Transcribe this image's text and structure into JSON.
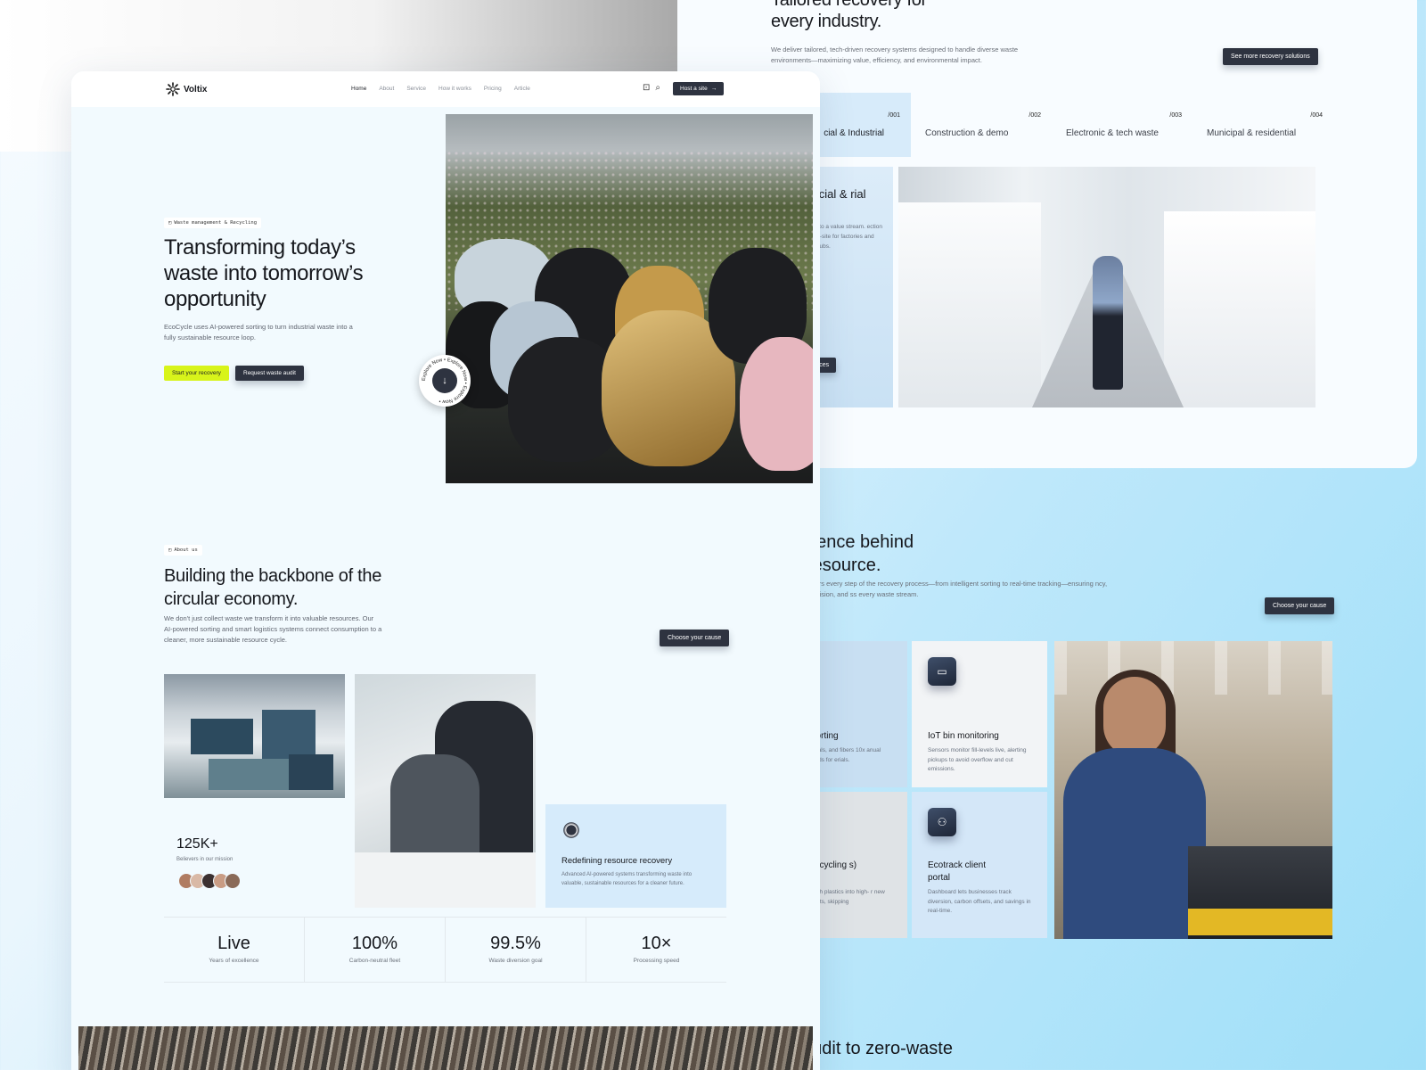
{
  "front": {
    "brand": "Voltix",
    "nav": {
      "links": [
        "Home",
        "About",
        "Service",
        "How it works",
        "Pricing",
        "Article"
      ],
      "host_button": "Host a site"
    },
    "hero": {
      "tag": "Waste management & Recycling",
      "title": "Transforming today’s waste into tomorrow’s opportunity",
      "description": "EcoCycle uses AI-powered sorting to turn industrial waste into a fully sustainable resource loop.",
      "primary_button": "Start your recovery",
      "secondary_button": "Request waste audit",
      "badge_text": "Explore Now • Explore Now • Explore Now •"
    },
    "about": {
      "tag": "About us",
      "title": "Building the backbone of the circular economy.",
      "description": "We don't just collect waste we transform it into valuable resources. Our AI-powered sorting and smart logistics systems connect consumption to a cleaner, more sustainable resource cycle.",
      "cta": "Choose your cause",
      "believers_value": "125K+",
      "believers_label": "Believers in our mission",
      "card_title": "Redefining resource recovery",
      "card_text": "Advanced AI-powered systems transforming waste into valuable, sustainable resources for a cleaner future."
    },
    "stats": [
      {
        "value": "Live",
        "label": "Years of excellence"
      },
      {
        "value": "100%",
        "label": "Carbon-neutral fleet"
      },
      {
        "value": "99.5%",
        "label": "Waste diversion goal"
      },
      {
        "value": "10×",
        "label": "Processing speed"
      }
    ]
  },
  "back": {
    "title": "Tailored recovery for every industry.",
    "description": "We deliver tailored, tech-driven recovery systems designed to handle diverse waste environments—maximizing value, efficiency, and environmental impact.",
    "cta": "See more recovery solutions",
    "tabs": [
      {
        "num": "/001",
        "label": "cial & Industrial"
      },
      {
        "num": "/002",
        "label": "Construction & demo"
      },
      {
        "num": "/003",
        "label": "Electronic & tech waste"
      },
      {
        "num": "/004",
        "label": "Municipal & residential"
      }
    ],
    "card": {
      "title": "nercial & rial",
      "text": "aste into a value stream. ection and on-site for factories and retail hubs.",
      "button": "ervices"
    },
    "intel_title": "gence behind resource.",
    "intel_desc": "owers every step of the recovery process—from intelligent sorting to real-time tracking—ensuring ncy, precision, and ss every waste stream.",
    "intel_cta": "Choose your cause",
    "features": [
      {
        "title": "al sorting",
        "text": "s, metals, and fibers 10x anual methods for erials."
      },
      {
        "title": "IoT bin monitoring",
        "text": "Sensors monitor fill-levels live, alerting pickups to avoid overflow and cut emissions."
      },
      {
        "title": "al recycling s)",
        "text": "ts tough plastics into high- r new products, skipping"
      },
      {
        "title": "Ecotrack client portal",
        "text": "Dashboard lets businesses track diversion, carbon offsets, and savings in real-time."
      }
    ],
    "bottom_text": "audit to zero-waste"
  }
}
